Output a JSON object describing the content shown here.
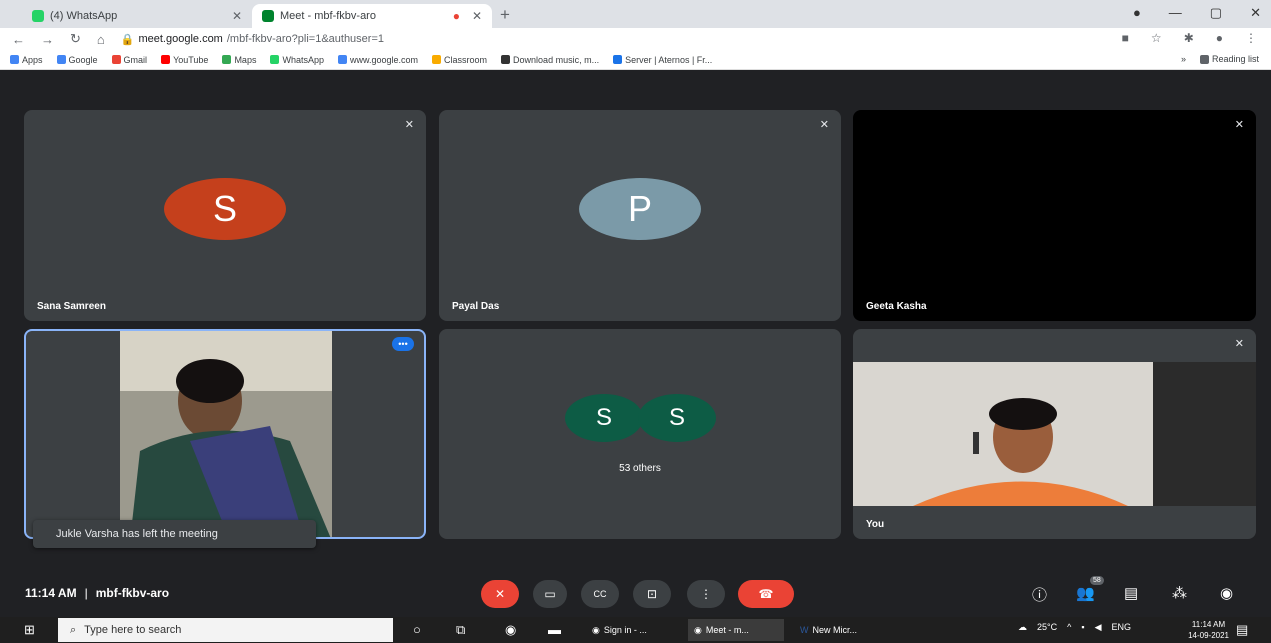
{
  "browser": {
    "tabs": [
      {
        "label": "(4) WhatsApp",
        "color": "#25d366"
      },
      {
        "label": "Meet - mbf-fkbv-aro",
        "color": "#00832d"
      }
    ],
    "url_host": "meet.google.com",
    "url_path": "/mbf-fkbv-aro?pli=1&authuser=1",
    "bookmarks": [
      "Apps",
      "Google",
      "Gmail",
      "YouTube",
      "Maps",
      "WhatsApp",
      "www.google.com",
      "Classroom",
      "Download music, m...",
      "Server | Aternos | Fr..."
    ],
    "reading_list": "Reading list"
  },
  "tiles": {
    "t1": {
      "name": "Sana Samreen",
      "initial": "S",
      "color": "#c5401c"
    },
    "t2": {
      "name": "Payal Das",
      "initial": "P",
      "color": "#7b9aa8"
    },
    "t3": {
      "name": "Geeta Kasha"
    },
    "t5": {
      "initial_a": "S",
      "initial_b": "S",
      "color": "#0d5c45",
      "others": "53 others"
    },
    "t6": {
      "name": "You"
    }
  },
  "toast": "Jukle Varsha has left the meeting",
  "meeting": {
    "time": "11:14 AM",
    "separator": "|",
    "code": "mbf-fkbv-aro",
    "people_count": "58"
  },
  "taskbar": {
    "search_placeholder": "Type here to search",
    "apps": [
      "Sign in - ...",
      "Meet - m...",
      "New Micr..."
    ],
    "weather": "25°C",
    "lang": "ENG",
    "time": "11:14 AM",
    "date": "14-09-2021"
  }
}
